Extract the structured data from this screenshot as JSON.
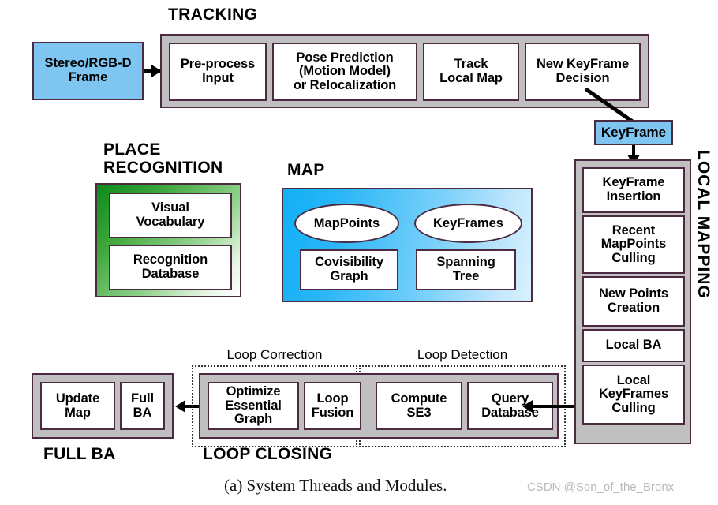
{
  "figure": {
    "caption": "(a) System Threads and Modules.",
    "watermark": "CSDN @Son_of_the_Bronx"
  },
  "colors": {
    "data_box_blue": "#7ec5f2",
    "module_gray": "#c0c0c0",
    "border_purple": "#4c2a42",
    "place_recognition_green": "#0a8a18",
    "map_blue": "#12b0f6"
  },
  "tracking": {
    "title": "TRACKING",
    "input": {
      "label": "Stereo/RGB-D\nFrame"
    },
    "steps": [
      {
        "label": "Pre-process\nInput"
      },
      {
        "label": "Pose Prediction\n(Motion Model)\nor Relocalization"
      },
      {
        "label": "Track\nLocal Map"
      },
      {
        "label": "New KeyFrame\nDecision"
      }
    ]
  },
  "keyframe": {
    "label": "KeyFrame"
  },
  "local_mapping": {
    "title": "LOCAL MAPPING",
    "steps": [
      {
        "label": "KeyFrame\nInsertion"
      },
      {
        "label": "Recent\nMapPoints\nCulling"
      },
      {
        "label": "New Points\nCreation"
      },
      {
        "label": "Local BA"
      },
      {
        "label": "Local\nKeyFrames\nCulling"
      }
    ]
  },
  "place_recognition": {
    "title": "PLACE\nRECOGNITION",
    "items": [
      {
        "label": "Visual\nVocabulary"
      },
      {
        "label": "Recognition\nDatabase"
      }
    ]
  },
  "map": {
    "title": "MAP",
    "ellipses": [
      {
        "label": "MapPoints"
      },
      {
        "label": "KeyFrames"
      }
    ],
    "boxes": [
      {
        "label": "Covisibility\nGraph"
      },
      {
        "label": "Spanning\nTree"
      }
    ]
  },
  "full_ba": {
    "title": "FULL BA",
    "steps": [
      {
        "label": "Update\nMap"
      },
      {
        "label": "Full\nBA"
      }
    ]
  },
  "loop_closing": {
    "title": "LOOP CLOSING",
    "groups": [
      {
        "label": "Loop Correction",
        "steps": [
          {
            "label": "Optimize\nEssential\nGraph"
          },
          {
            "label": "Loop\nFusion"
          }
        ]
      },
      {
        "label": "Loop Detection",
        "steps": [
          {
            "label": "Compute\nSE3"
          },
          {
            "label": "Query\nDatabase"
          }
        ]
      }
    ]
  }
}
